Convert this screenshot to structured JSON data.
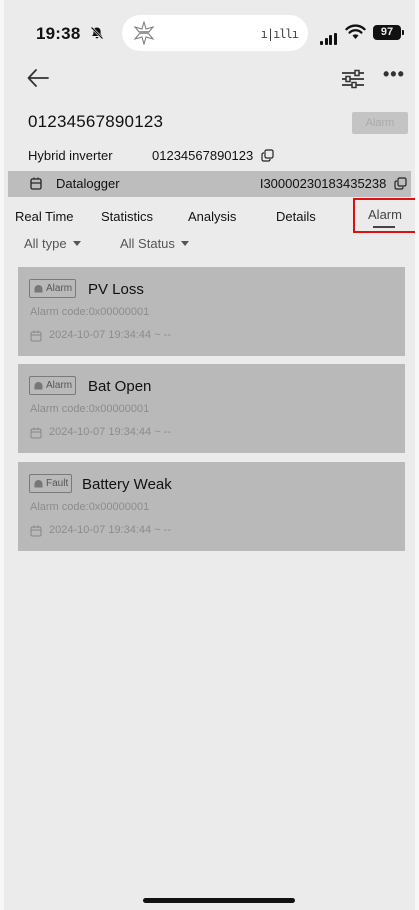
{
  "status_bar": {
    "time": "19:38",
    "battery": "97"
  },
  "device": {
    "serial": "01234567890123",
    "alarm_button": "Alarm",
    "type_label": "Hybrid inverter",
    "type_serial": "01234567890123",
    "logger_label": "Datalogger",
    "logger_serial": "I30000230183435238"
  },
  "tabs": [
    "Real Time",
    "Statistics",
    "Analysis",
    "Details",
    "Alarm"
  ],
  "filters": {
    "type": "All type",
    "status": "All Status"
  },
  "alarms": [
    {
      "badge": "Alarm",
      "title": "PV Loss",
      "code": "Alarm code:0x00000001",
      "date": "2024-10-07 19:34:44 ~ --"
    },
    {
      "badge": "Alarm",
      "title": "Bat Open",
      "code": "Alarm code:0x00000001",
      "date": "2024-10-07 19:34:44 ~ --"
    },
    {
      "badge": "Fault",
      "title": "Battery Weak",
      "code": "Alarm code:0x00000001",
      "date": "2024-10-07 19:34:44 ~ --"
    }
  ],
  "icons": [
    "bell-off-icon",
    "signal-icon",
    "wifi-icon",
    "battery-icon",
    "back-arrow-icon",
    "filter-sliders-icon",
    "more-icon",
    "copy-icon",
    "datalogger-icon",
    "alarm-badge-icon",
    "calendar-icon"
  ],
  "colors": {
    "highlight": "#e01010",
    "card": "#b9b9b9",
    "background": "#ebebeb"
  }
}
